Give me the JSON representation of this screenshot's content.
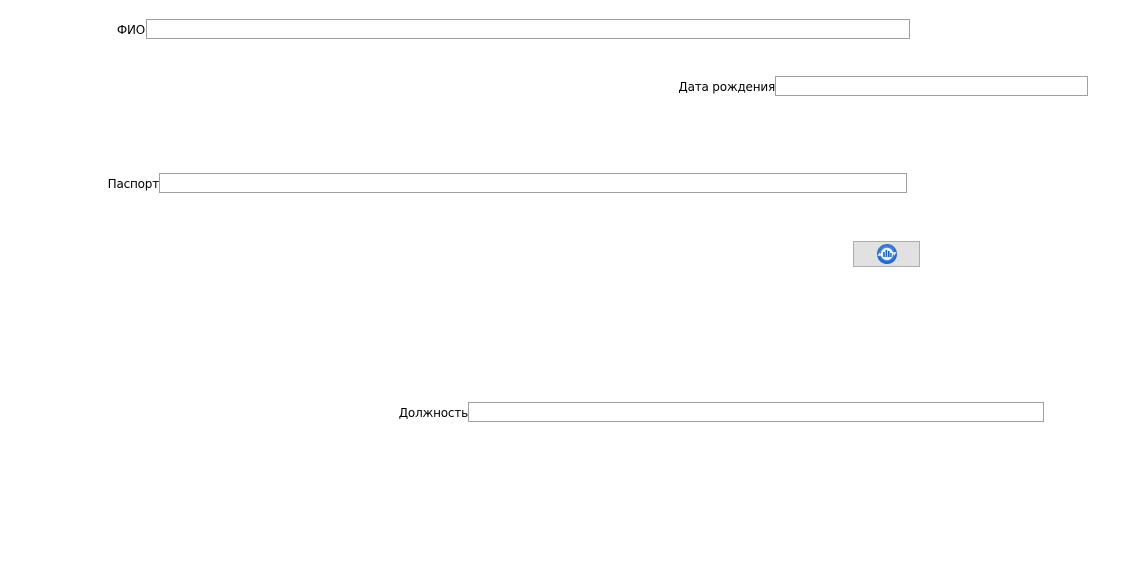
{
  "form": {
    "fio": {
      "label": "ФИО",
      "value": ""
    },
    "birth_date": {
      "label": "Дата рождения",
      "value": ""
    },
    "passport": {
      "label": "Паспорт",
      "value": ""
    },
    "position": {
      "label": "Должность",
      "value": ""
    }
  },
  "refresh_button": {
    "icon": "refresh-icon",
    "icon_color": "#1f6fd1"
  }
}
